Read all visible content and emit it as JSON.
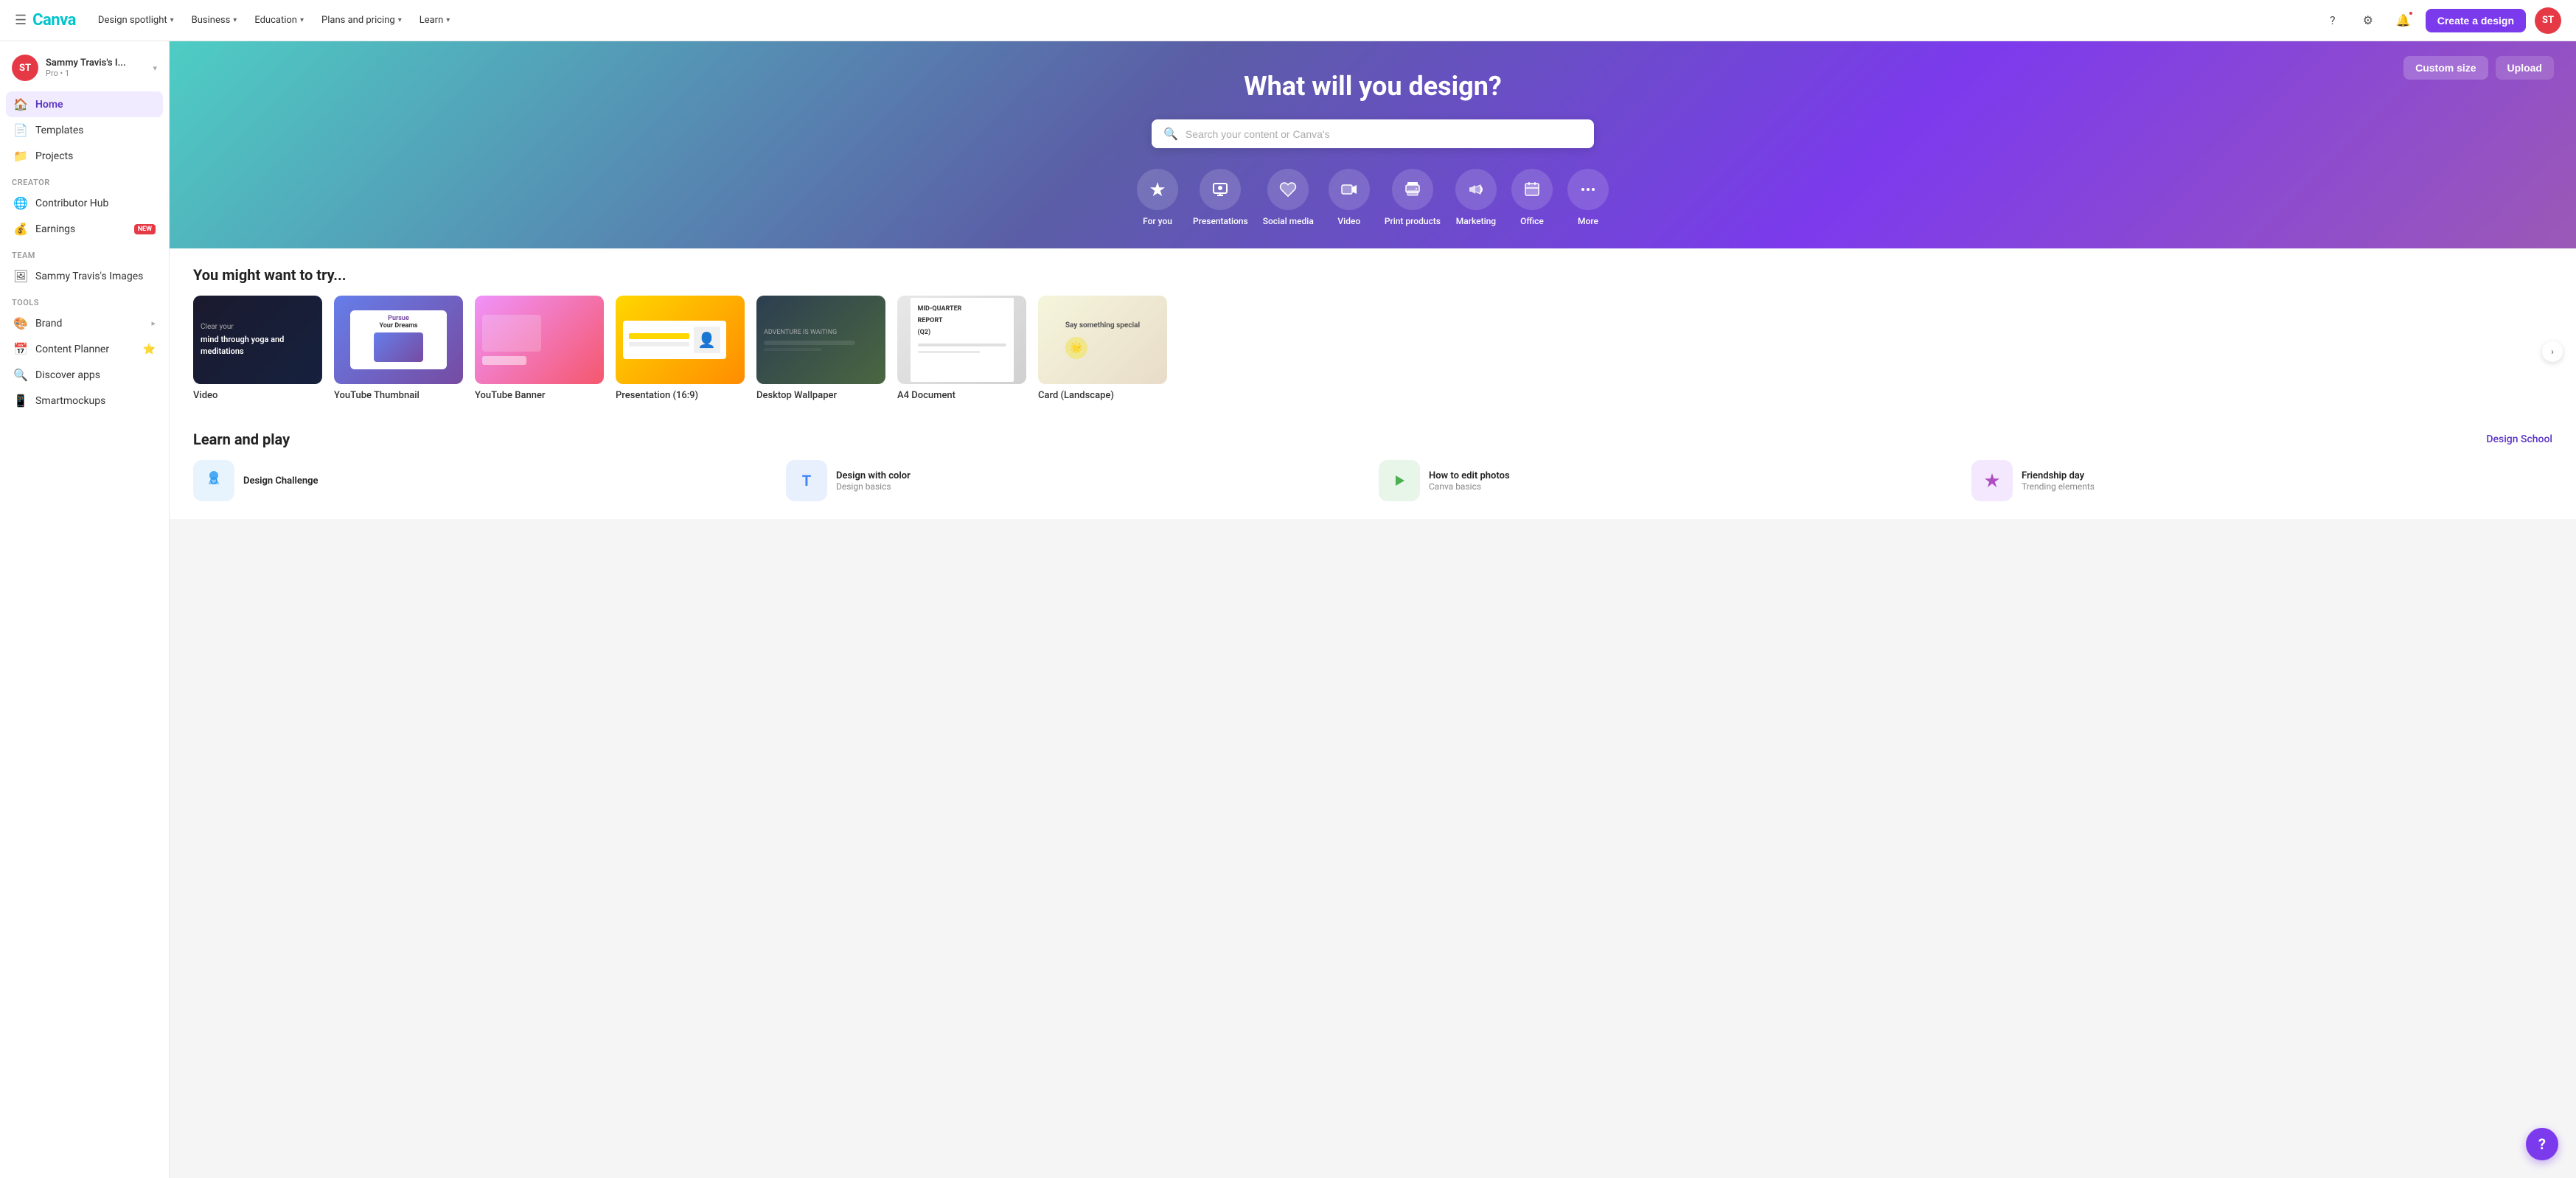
{
  "topNav": {
    "hamburger": "☰",
    "logo": "Canva",
    "links": [
      {
        "label": "Design spotlight",
        "id": "design-spotlight"
      },
      {
        "label": "Business",
        "id": "business"
      },
      {
        "label": "Education",
        "id": "education"
      },
      {
        "label": "Plans and pricing",
        "id": "plans"
      },
      {
        "label": "Learn",
        "id": "learn"
      }
    ],
    "helpIcon": "?",
    "settingsIcon": "⚙",
    "notificationIcon": "🔔",
    "createBtn": "Create a design",
    "avatarText": "ST"
  },
  "sidebar": {
    "accountName": "Sammy Travis's I...",
    "accountSub": "Pro • 1",
    "avatarText": "ST",
    "navItems": [
      {
        "label": "Home",
        "icon": "🏠",
        "id": "home",
        "active": true
      },
      {
        "label": "Templates",
        "icon": "📄",
        "id": "templates"
      },
      {
        "label": "Projects",
        "icon": "📁",
        "id": "projects"
      }
    ],
    "creatorSection": "Creator",
    "creatorItems": [
      {
        "label": "Contributor Hub",
        "icon": "🌐",
        "id": "contributor-hub"
      },
      {
        "label": "Earnings",
        "icon": "💰",
        "id": "earnings",
        "badge": "NEW"
      }
    ],
    "teamSection": "Team",
    "teamItems": [
      {
        "label": "Sammy Travis's Images",
        "icon": "🖼",
        "id": "team-images"
      }
    ],
    "toolsSection": "Tools",
    "toolsItems": [
      {
        "label": "Brand",
        "icon": "🎨",
        "id": "brand",
        "hasExpand": true
      },
      {
        "label": "Content Planner",
        "icon": "📅",
        "id": "content-planner",
        "badgeStar": "⭐"
      },
      {
        "label": "Discover apps",
        "icon": "🔍",
        "id": "discover-apps"
      },
      {
        "label": "Smartmockups",
        "icon": "📱",
        "id": "smartmockups"
      }
    ]
  },
  "hero": {
    "title": "What will you design?",
    "searchPlaceholder": "Search your content or Canva's",
    "customSizeBtn": "Custom size",
    "uploadBtn": "Upload",
    "quickIcons": [
      {
        "label": "For you",
        "icon": "✦",
        "id": "for-you"
      },
      {
        "label": "Presentations",
        "icon": "📊",
        "id": "presentations"
      },
      {
        "label": "Social media",
        "icon": "💜",
        "id": "social-media"
      },
      {
        "label": "Video",
        "icon": "▶",
        "id": "video"
      },
      {
        "label": "Print products",
        "icon": "🖨",
        "id": "print-products"
      },
      {
        "label": "Marketing",
        "icon": "📣",
        "id": "marketing"
      },
      {
        "label": "Office",
        "icon": "💼",
        "id": "office"
      },
      {
        "label": "More",
        "icon": "•••",
        "id": "more"
      }
    ]
  },
  "trySection": {
    "title": "You might want to try...",
    "cards": [
      {
        "label": "Video",
        "id": "video-card",
        "thumbClass": "thumb-video"
      },
      {
        "label": "YouTube Thumbnail",
        "id": "yt-thumb-card",
        "thumbClass": "thumb-yt-thumb"
      },
      {
        "label": "YouTube Banner",
        "id": "yt-banner-card",
        "thumbClass": "thumb-yt-banner"
      },
      {
        "label": "Presentation (16:9)",
        "id": "presentation-card",
        "thumbClass": "thumb-presentation"
      },
      {
        "label": "Desktop Wallpaper",
        "id": "wallpaper-card",
        "thumbClass": "thumb-wallpaper"
      },
      {
        "label": "A4 Document",
        "id": "a4-card",
        "thumbClass": "thumb-a4"
      },
      {
        "label": "Card (Landscape)",
        "id": "card-landscape-card",
        "thumbClass": "thumb-card"
      }
    ]
  },
  "learnSection": {
    "title": "Learn and play",
    "linkLabel": "Design School",
    "cards": [
      {
        "title": "Design Challenge",
        "sub": "",
        "iconClass": "learn-icon-challenge",
        "icon": "🏆",
        "id": "design-challenge"
      },
      {
        "title": "Design with color",
        "sub": "Design basics",
        "iconClass": "learn-icon-color",
        "icon": "T",
        "id": "design-color"
      },
      {
        "title": "How to edit photos",
        "sub": "Canva basics",
        "iconClass": "learn-icon-photos",
        "icon": "✈",
        "id": "edit-photos"
      },
      {
        "title": "Friendship day",
        "sub": "Trending elements",
        "iconClass": "learn-icon-friendship",
        "icon": "✦",
        "id": "friendship-day"
      }
    ]
  },
  "helpBtn": "?"
}
